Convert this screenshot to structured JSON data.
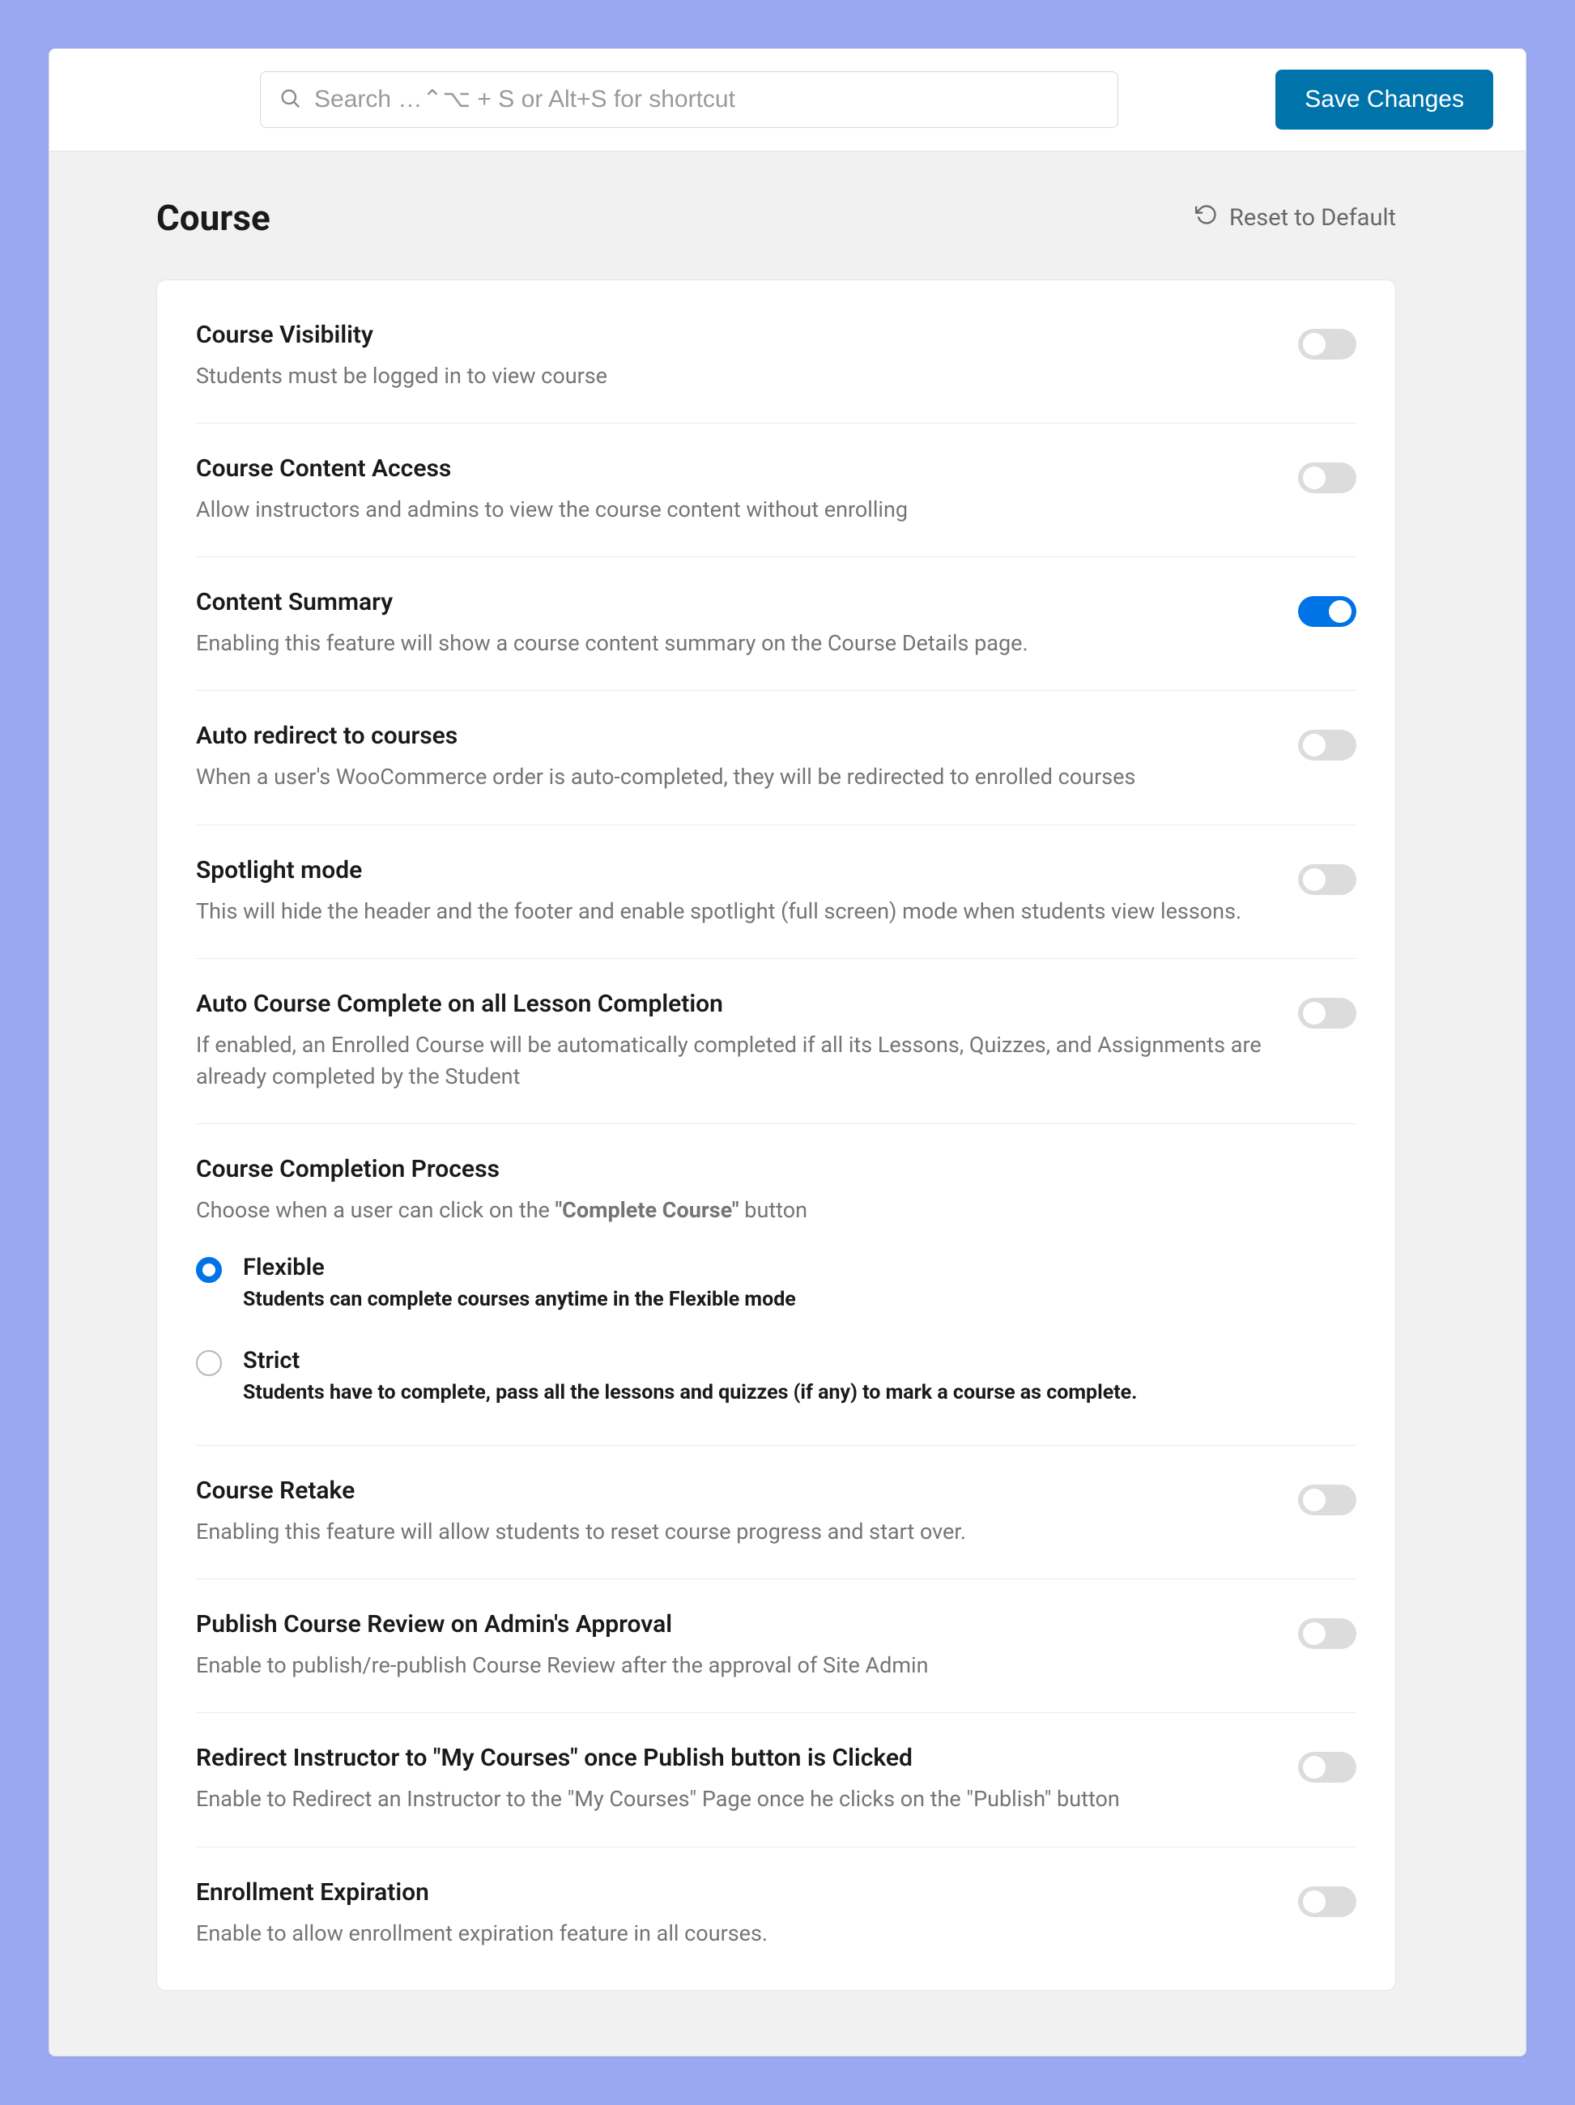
{
  "header": {
    "search_placeholder": "Search …⌃⌥ + S or Alt+S for shortcut",
    "save_label": "Save Changes"
  },
  "page": {
    "title": "Course",
    "reset_label": "Reset to Default"
  },
  "settings": {
    "course_visibility": {
      "title": "Course Visibility",
      "desc": "Students must be logged in to view course",
      "on": false
    },
    "course_content_access": {
      "title": "Course Content Access",
      "desc": "Allow instructors and admins to view the course content without enrolling",
      "on": false
    },
    "content_summary": {
      "title": "Content Summary",
      "desc": "Enabling this feature will show a course content summary on the Course Details page.",
      "on": true
    },
    "auto_redirect": {
      "title": "Auto redirect to courses",
      "desc": "When a user's WooCommerce order is auto-completed, they will be redirected to enrolled courses",
      "on": false
    },
    "spotlight": {
      "title": "Spotlight mode",
      "desc": "This will hide the header and the footer and enable spotlight (full screen) mode when students view lessons.",
      "on": false
    },
    "auto_complete": {
      "title": "Auto Course Complete on all Lesson Completion",
      "desc": "If enabled, an Enrolled Course will be automatically completed if all its Lessons, Quizzes, and Assignments are already completed by the Student",
      "on": false
    },
    "completion_process": {
      "title": "Course Completion Process",
      "desc_pre": "Choose when a user can click on the ",
      "desc_bold": "\"Complete Course\"",
      "desc_post": " button",
      "selected": "flexible",
      "options": {
        "flexible": {
          "title": "Flexible",
          "sub": "Students can complete courses anytime in the Flexible mode"
        },
        "strict": {
          "title": "Strict",
          "sub": "Students have to complete, pass all the lessons and quizzes (if any) to mark a course as complete."
        }
      }
    },
    "course_retake": {
      "title": "Course Retake",
      "desc": "Enabling this feature will allow students to reset course progress and start over.",
      "on": false
    },
    "publish_review": {
      "title": "Publish Course Review on Admin's Approval",
      "desc": "Enable to publish/re-publish Course Review after the approval of Site Admin",
      "on": false
    },
    "redirect_instructor": {
      "title": "Redirect Instructor to \"My Courses\" once Publish button is Clicked",
      "desc": "Enable to Redirect an Instructor to the \"My Courses\" Page once he clicks on the \"Publish\" button",
      "on": false
    },
    "enrollment_expiration": {
      "title": "Enrollment Expiration",
      "desc": "Enable to allow enrollment expiration feature in all courses.",
      "on": false
    }
  }
}
